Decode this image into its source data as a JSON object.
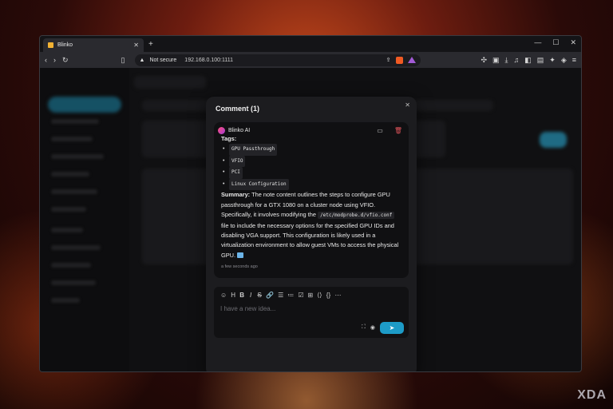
{
  "browser": {
    "tab_title": "Blinko",
    "tab_close": "✕",
    "new_tab": "+",
    "window_controls": [
      "—",
      "☐",
      "✕"
    ],
    "security_label": "Not secure",
    "url": "192.168.0.100:1111"
  },
  "modal": {
    "title": "Comment (1)",
    "close": "✕"
  },
  "comment": {
    "author": "Blinko AI",
    "tags_label": "Tags:",
    "tags": [
      "GPU Passthrough",
      "VFIO",
      "PCI",
      "Linux Configuration"
    ],
    "summary_label": "Summary:",
    "summary_part1": "The note content outlines the steps to configure GPU passthrough for a GTX 1080 on a cluster node using VFIO. Specifically, it involves modifying the",
    "summary_code": "/etc/modprobe.d/vfio.conf",
    "summary_part2": "file to include the necessary options for the specified GPU IDs and disabling VGA support. This configuration is likely used in a virtualization environment to allow guest VMs to access the physical GPU.",
    "timestamp": "a few seconds ago"
  },
  "editor": {
    "placeholder": "I have a new idea...",
    "send_label": "➤"
  },
  "watermark": "XDA"
}
